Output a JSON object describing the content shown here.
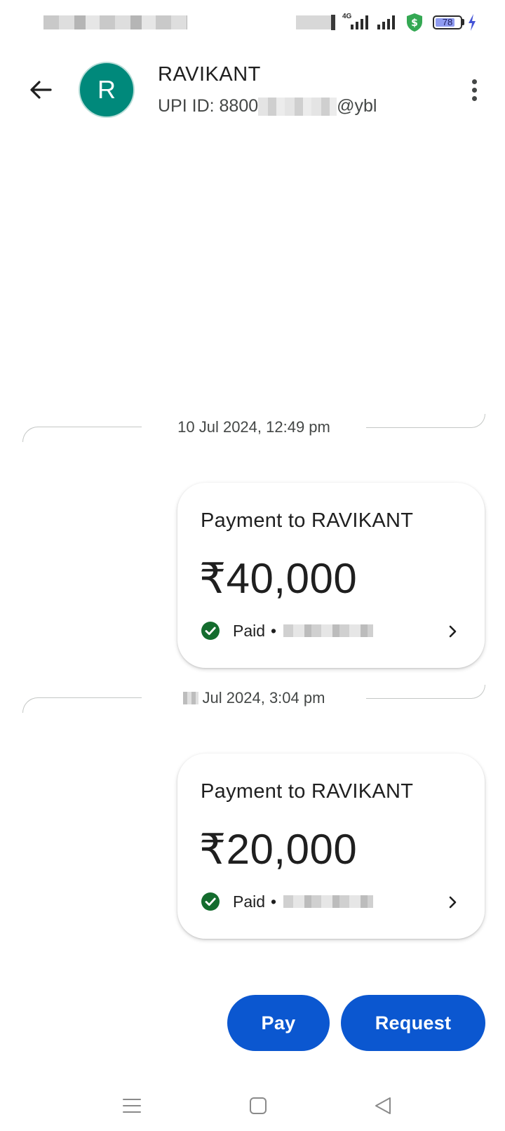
{
  "status_bar": {
    "network_label": "4G",
    "battery_level": "78",
    "colors": {
      "shield": "#34a853",
      "bolt": "#4353d6",
      "battery_fill": "#8f9bf0"
    }
  },
  "header": {
    "contact_initial": "R",
    "contact_name": "RAVIKANT",
    "upi_prefix": "UPI ID: 8800",
    "upi_suffix": "@ybl",
    "avatar_color": "#00897b"
  },
  "transactions": [
    {
      "date": "10 Jul 2024, 12:49 pm",
      "title": "Payment to RAVIKANT",
      "amount": "₹40,000",
      "status": "Paid",
      "separator": "•"
    },
    {
      "date": "Jul 2024, 3:04 pm",
      "title": "Payment to RAVIKANT",
      "amount": "₹20,000",
      "status": "Paid",
      "separator": "•"
    }
  ],
  "actions": {
    "pay_label": "Pay",
    "request_label": "Request",
    "button_color": "#0b57d0"
  },
  "icons": {
    "back": "arrow-back-icon",
    "more": "more-vert-icon",
    "check": "check-circle-icon",
    "chevron": "chevron-right-icon",
    "nav": [
      "menu-icon",
      "home-square-icon",
      "back-triangle-icon"
    ]
  }
}
